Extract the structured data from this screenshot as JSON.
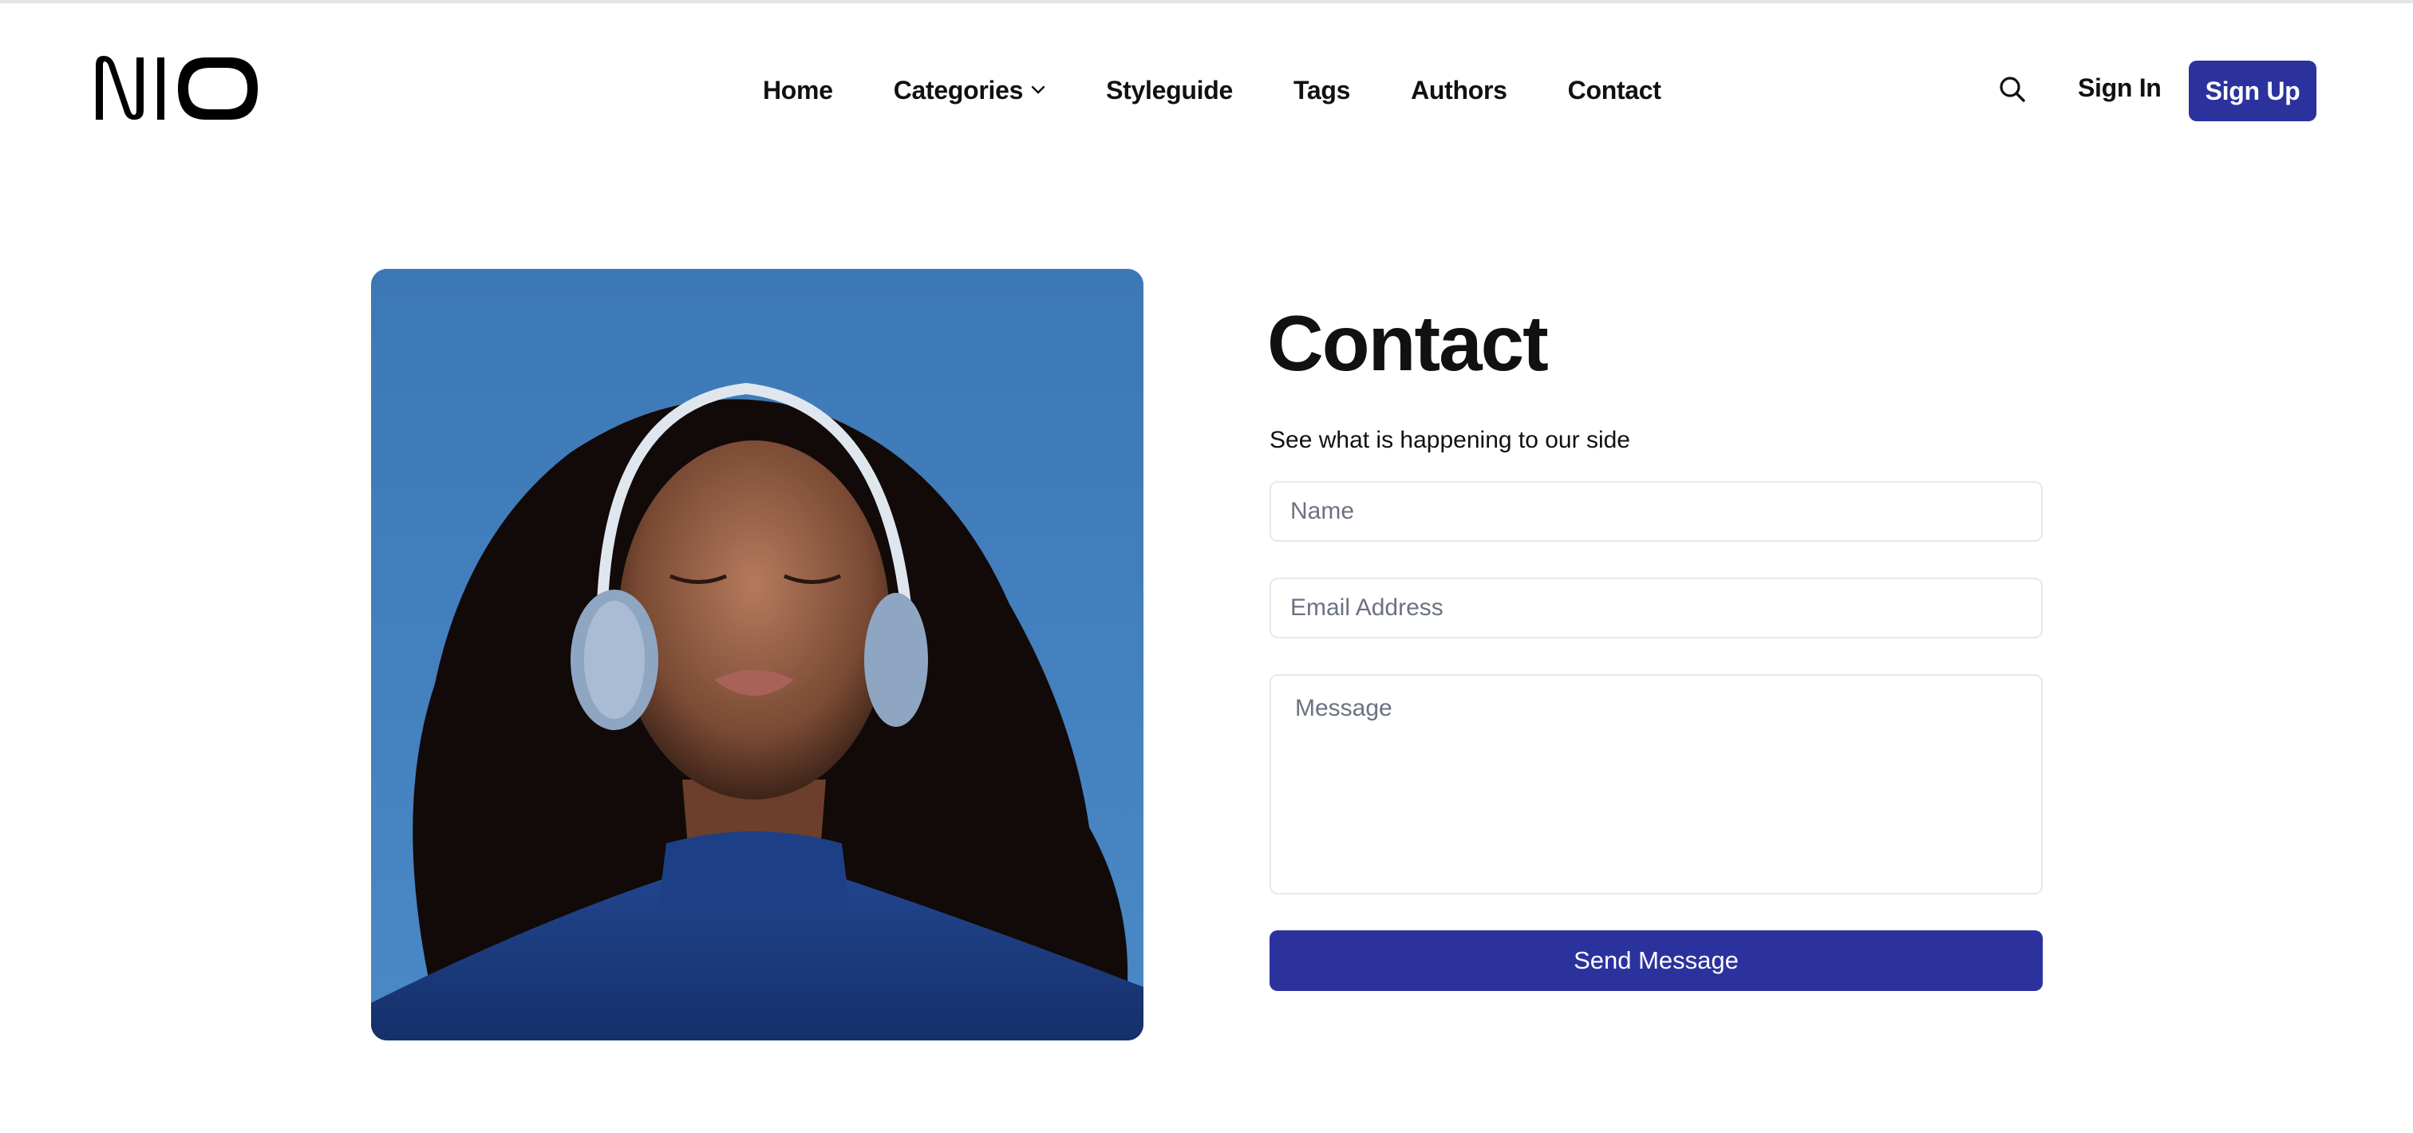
{
  "header": {
    "logo_text": "NIO",
    "nav": [
      {
        "label": "Home"
      },
      {
        "label": "Categories",
        "has_dropdown": true
      },
      {
        "label": "Styleguide"
      },
      {
        "label": "Tags"
      },
      {
        "label": "Authors"
      },
      {
        "label": "Contact"
      }
    ],
    "search_icon": "search-icon",
    "sign_in_label": "Sign In",
    "sign_up_label": "Sign Up"
  },
  "hero_image": {
    "alt": "Woman with curly hair wearing light blue headphones, eyes closed, blue turtleneck against blue sky"
  },
  "contact": {
    "title": "Contact",
    "subtitle": "See what is happening to our side",
    "name_placeholder": "Name",
    "name_value": "",
    "email_placeholder": "Email Address",
    "email_value": "",
    "message_placeholder": "Message",
    "message_value": "",
    "submit_label": "Send Message"
  },
  "colors": {
    "accent": "#2c329d",
    "text": "#111111",
    "placeholder": "#6b7280",
    "border": "#e8e8e8",
    "image_sky": "#3f7cb9"
  }
}
